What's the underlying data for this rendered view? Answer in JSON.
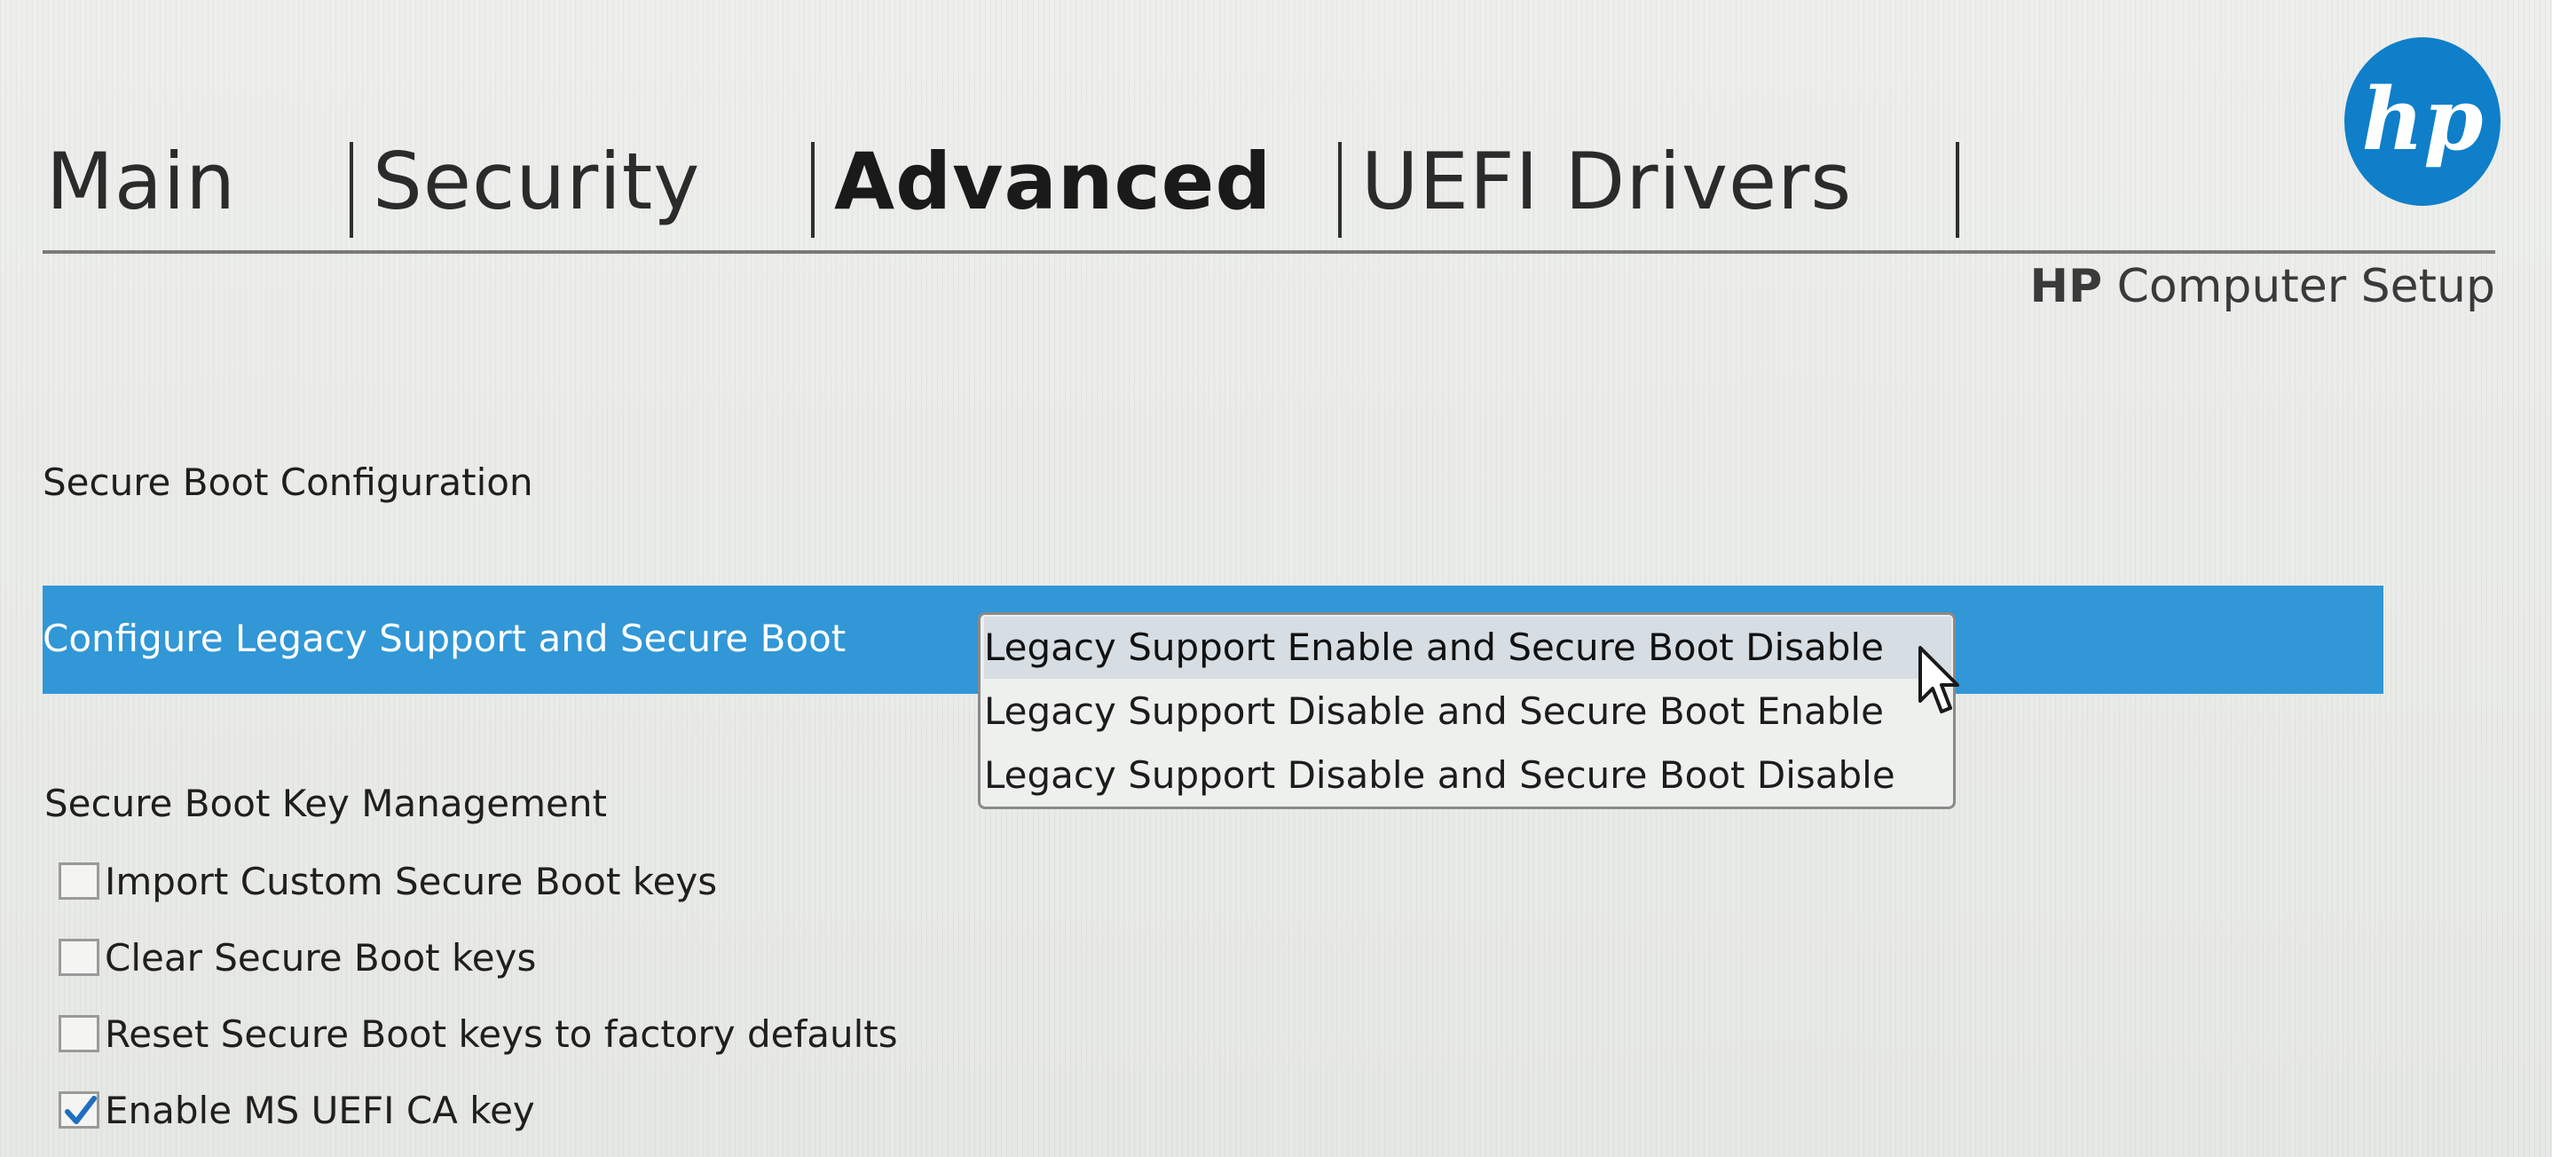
{
  "tabs": [
    {
      "label": "Main",
      "active": false
    },
    {
      "label": "Security",
      "active": false
    },
    {
      "label": "Advanced",
      "active": true
    },
    {
      "label": "UEFI Drivers",
      "active": false
    }
  ],
  "header": {
    "logo_text": "hp",
    "brand": "HP",
    "product": " Computer Setup"
  },
  "section": {
    "title": "Secure Boot Configuration"
  },
  "setting": {
    "label": "Configure Legacy Support and Secure Boot",
    "options": [
      "Legacy Support Enable and Secure Boot Disable",
      "Legacy Support Disable and Secure Boot Enable",
      "Legacy Support Disable and Secure Boot Disable"
    ],
    "selected_option": "Legacy Support Enable and Secure Boot Disable"
  },
  "key_management": {
    "title": "Secure Boot Key Management",
    "items": [
      {
        "label": "Import Custom Secure Boot keys",
        "checked": false
      },
      {
        "label": "Clear Secure Boot keys",
        "checked": false
      },
      {
        "label": "Reset Secure Boot keys to factory defaults",
        "checked": false
      },
      {
        "label": "Enable MS UEFI CA key",
        "checked": true
      }
    ]
  },
  "colors": {
    "highlight": "#3197d6",
    "hp_blue": "#0f7fc9",
    "check_blue": "#1f6fc0"
  },
  "icons": {
    "logo": "hp-logo-icon",
    "cursor": "mouse-pointer-icon",
    "checkmark": "checkmark-icon"
  }
}
